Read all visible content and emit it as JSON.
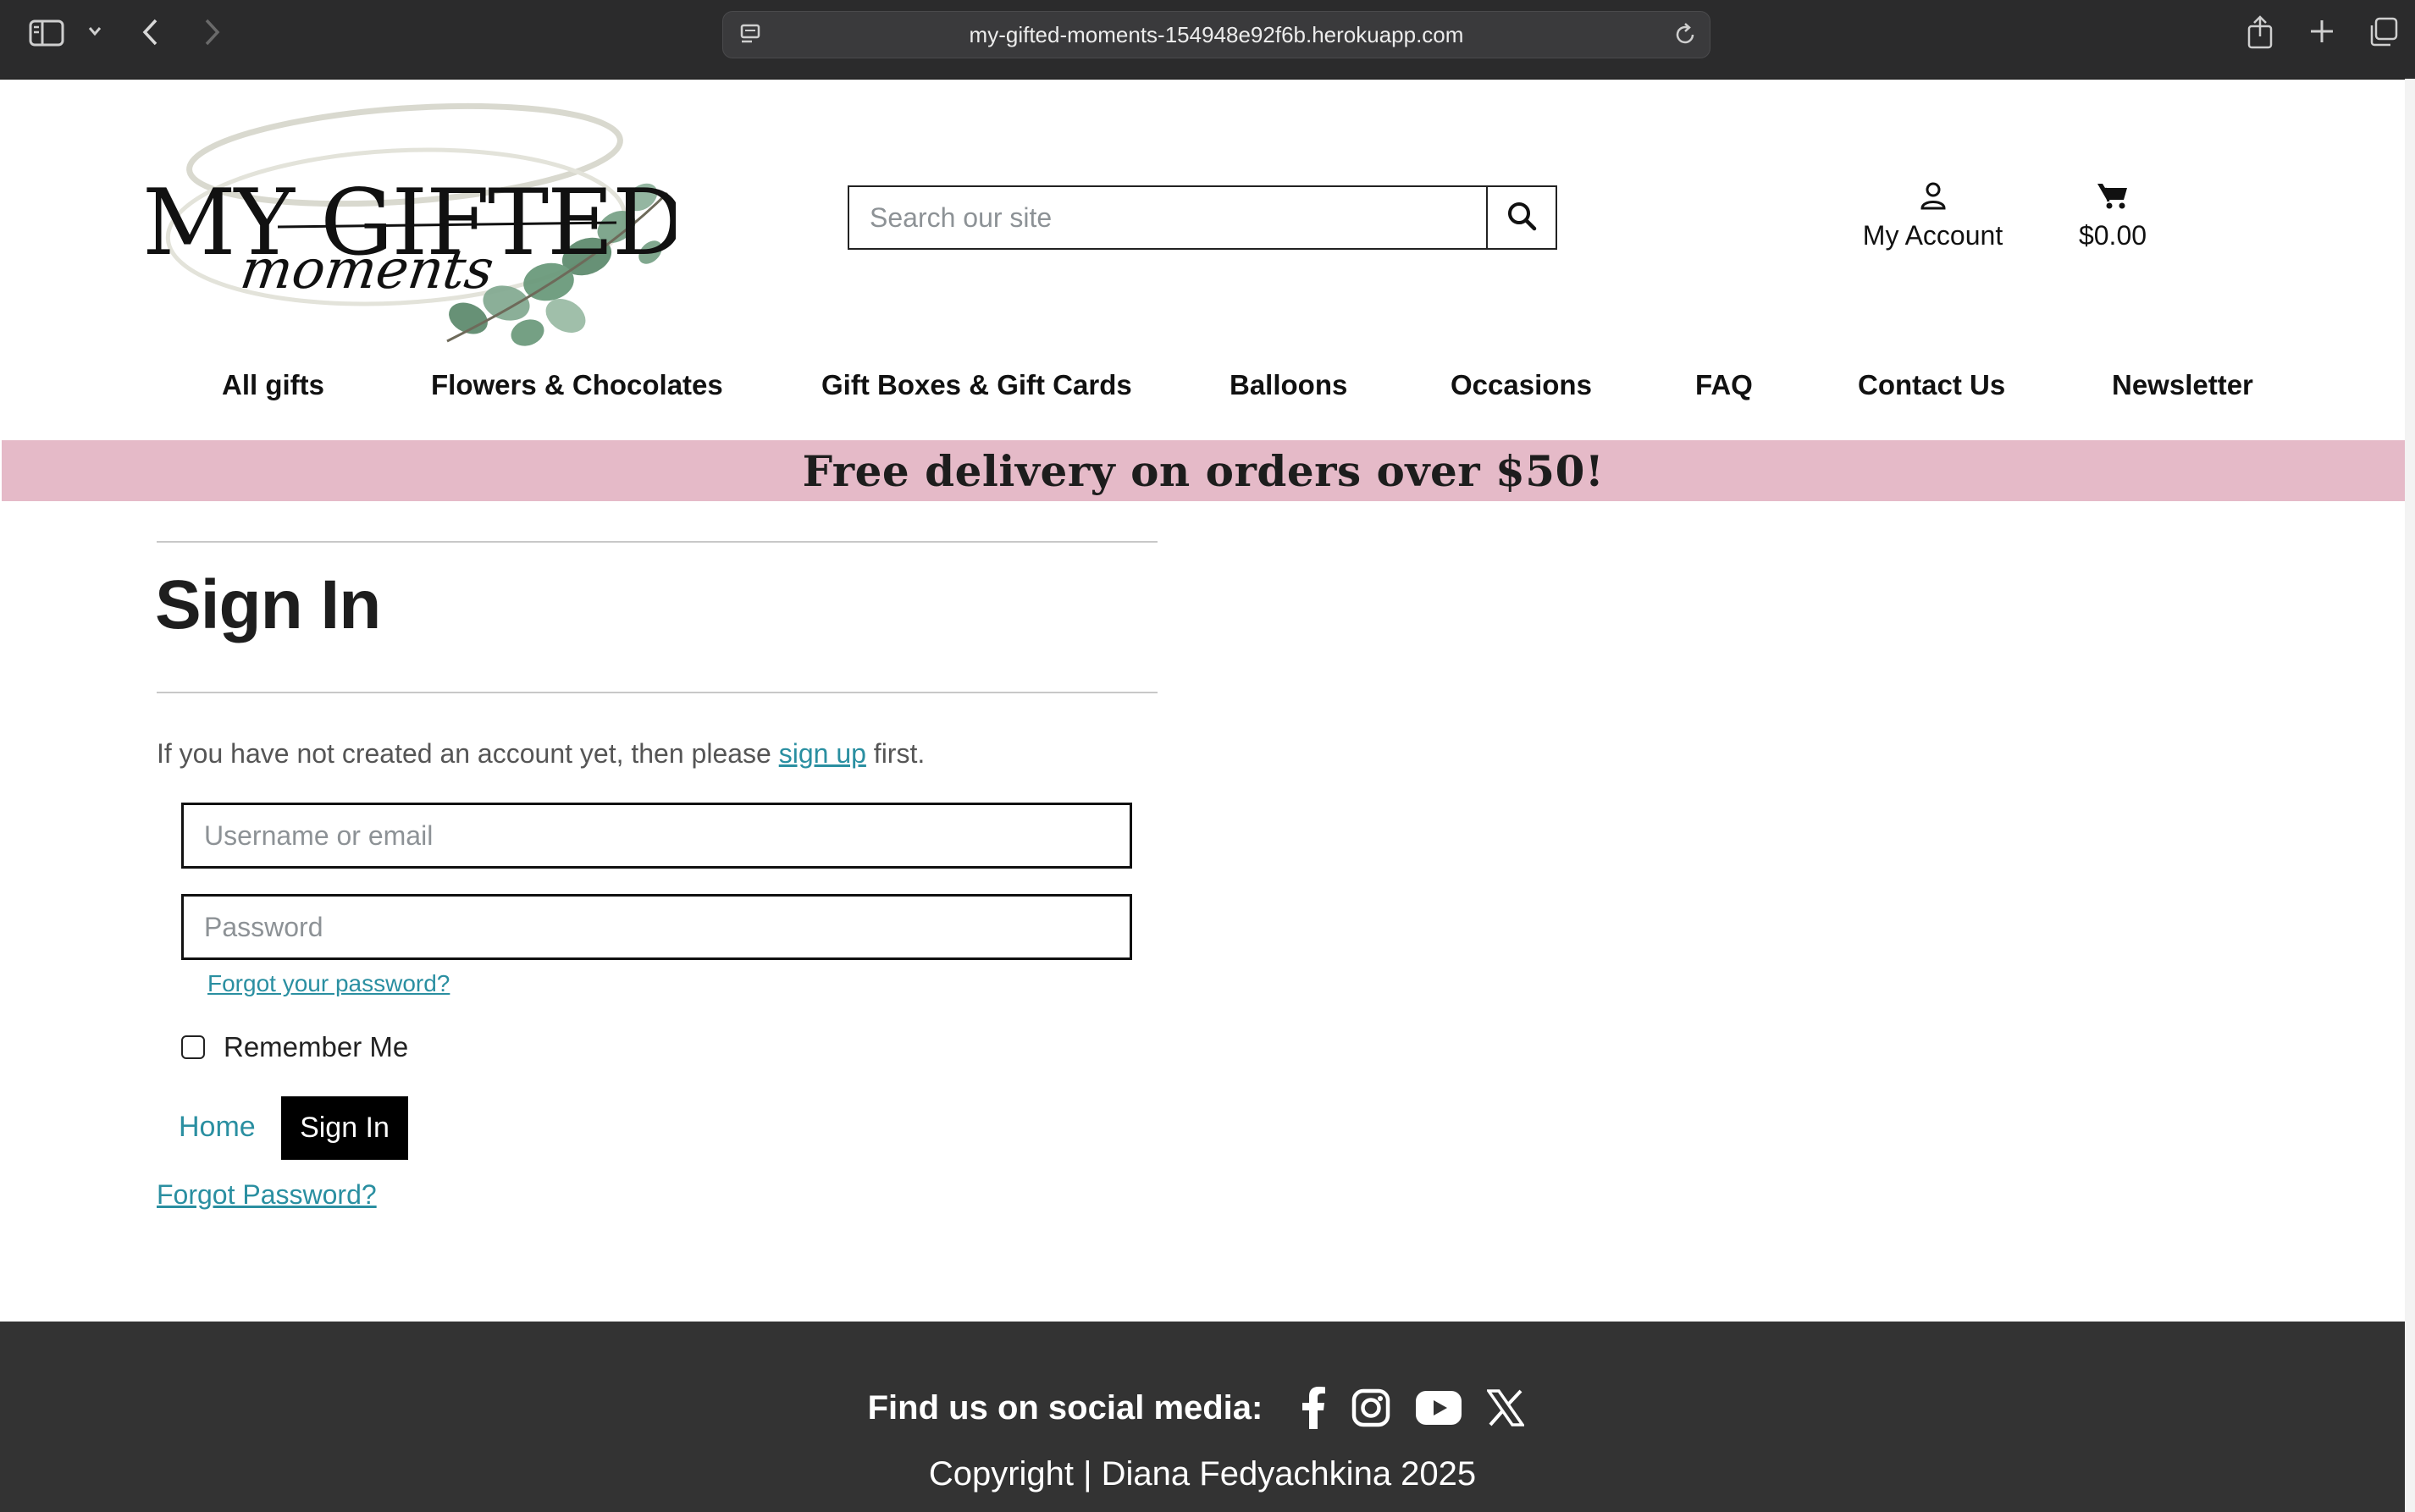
{
  "browser": {
    "url": "my-gifted-moments-154948e92f6b.herokuapp.com",
    "icons": [
      "sidebar-icon",
      "chevron-down-icon",
      "back-icon",
      "forward-icon",
      "site-icon",
      "reload-icon",
      "share-icon",
      "new-tab-icon",
      "tabs-overview-icon"
    ]
  },
  "header": {
    "logo": {
      "line1": "MY GIFTED",
      "line2": "moments"
    },
    "search": {
      "placeholder": "Search our site",
      "icon": "search-icon"
    },
    "account_label": "My Account",
    "cart_total": "$0.00"
  },
  "nav": {
    "items": [
      "All gifts",
      "Flowers & Chocolates",
      "Gift Boxes & Gift Cards",
      "Balloons",
      "Occasions",
      "FAQ",
      "Contact Us",
      "Newsletter"
    ]
  },
  "banner": {
    "text": "Free delivery on orders over $50!"
  },
  "signin": {
    "title": "Sign In",
    "intro_before": "If you have not created an account yet, then please ",
    "signup_link": "sign up",
    "intro_after": " first.",
    "username_placeholder": "Username or email",
    "password_placeholder": "Password",
    "forgot_small": "Forgot your password?",
    "remember_label": "Remember Me",
    "remember_checked": false,
    "home_label": "Home",
    "submit_label": "Sign In",
    "forgot_big": "Forgot Password?"
  },
  "footer": {
    "social_label": "Find us on social media:",
    "social_icons": [
      "facebook-icon",
      "instagram-icon",
      "youtube-icon",
      "x-icon"
    ],
    "copyright": "Copyright | Diana Fedyachkina 2025"
  },
  "colors": {
    "banner": "#e5bac8",
    "link": "#2a8fa1",
    "footer": "#333333",
    "chrome": "#2b2b2c"
  }
}
